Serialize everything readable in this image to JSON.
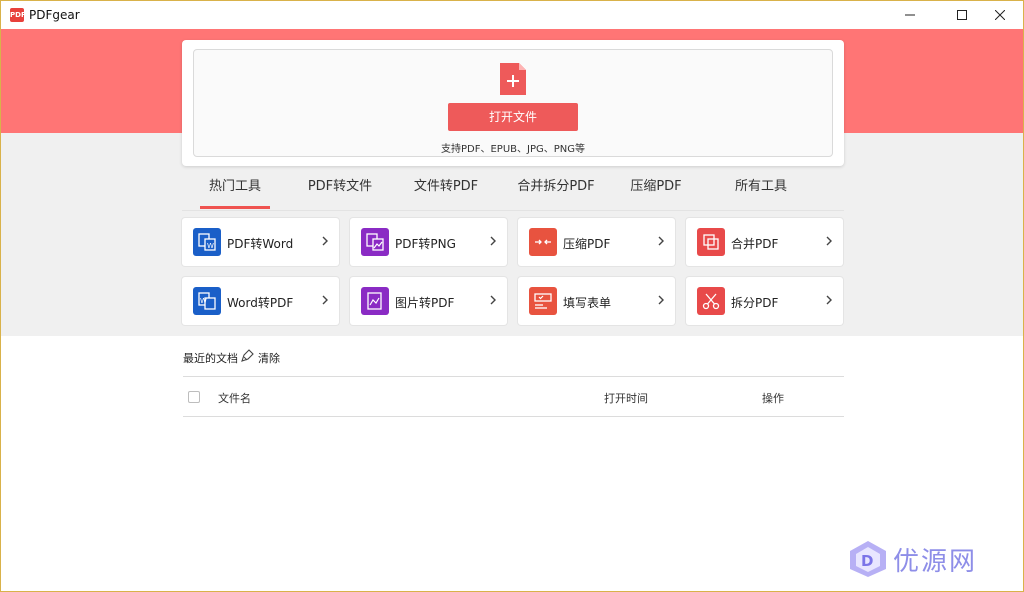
{
  "app": {
    "title": "PDFgear",
    "logo_text": "PDF"
  },
  "window_controls": {
    "minimize": "minimize-icon",
    "maximize": "maximize-icon",
    "close": "close-icon"
  },
  "upload": {
    "open_button": "打开文件",
    "support_text": "支持PDF、EPUB、JPG、PNG等",
    "icon": "file-plus-icon"
  },
  "tabs": [
    {
      "label": "热门工具",
      "active": true
    },
    {
      "label": "PDF转文件",
      "active": false
    },
    {
      "label": "文件转PDF",
      "active": false
    },
    {
      "label": "合并拆分PDF",
      "active": false
    },
    {
      "label": "压缩PDF",
      "active": false
    },
    {
      "label": "所有工具",
      "active": false
    }
  ],
  "tools": [
    {
      "label": "PDF转Word",
      "icon": "pdf-to-word-icon",
      "color": "#1a5fc8"
    },
    {
      "label": "PDF转PNG",
      "icon": "pdf-to-png-icon",
      "color": "#8a2bc4"
    },
    {
      "label": "压缩PDF",
      "icon": "compress-icon",
      "color": "#e8533f"
    },
    {
      "label": "合并PDF",
      "icon": "merge-icon",
      "color": "#e84a4a"
    },
    {
      "label": "Word转PDF",
      "icon": "word-to-pdf-icon",
      "color": "#1a5fc8"
    },
    {
      "label": "图片转PDF",
      "icon": "image-to-pdf-icon",
      "color": "#8a2bc4"
    },
    {
      "label": "填写表单",
      "icon": "form-icon",
      "color": "#e8533f"
    },
    {
      "label": "拆分PDF",
      "icon": "split-icon",
      "color": "#e84a4a"
    }
  ],
  "recent": {
    "title": "最近的文档",
    "clear": "清除",
    "columns": {
      "name": "文件名",
      "time": "打开时间",
      "action": "操作"
    }
  },
  "watermark": {
    "text": "优源网"
  },
  "colors": {
    "hero": "#ff7575",
    "accent": "#ef5350",
    "button": "#ee5a5a"
  }
}
